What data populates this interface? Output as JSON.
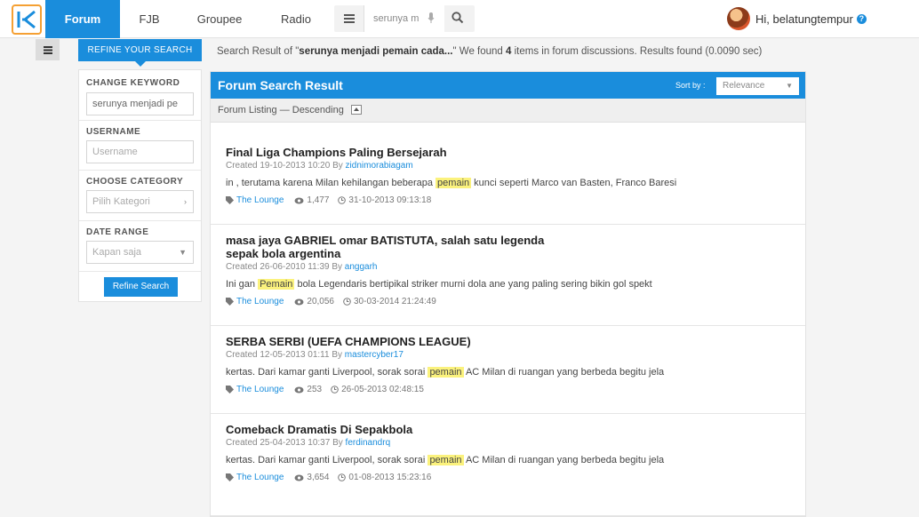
{
  "nav": {
    "tabs": [
      {
        "label": "Forum"
      },
      {
        "label": "FJB"
      },
      {
        "label": "Groupee"
      },
      {
        "label": "Radio"
      }
    ],
    "search": {
      "value": "serunya m"
    },
    "user": {
      "greeting": "Hi, belatungtempur",
      "help": "?"
    }
  },
  "sidebar": {
    "header": "REFINE YOUR SEARCH",
    "keyword_label": "CHANGE KEYWORD",
    "keyword_value": "serunya menjadi pe",
    "username_label": "USERNAME",
    "username_placeholder": "Username",
    "category_label": "CHOOSE CATEGORY",
    "category_value": "Pilih Kategori",
    "date_label": "DATE RANGE",
    "date_value": "Kapan saja",
    "refine_button": "Refine Search"
  },
  "summary": {
    "prefix": "Search Result of \"",
    "query": "serunya menjadi pemain cada...",
    "middle": "\" We found ",
    "count": "4",
    "suffix": " items in forum discussions. Results found (0.0090 sec)"
  },
  "main": {
    "title": "Forum Search Result",
    "sort_label": "Sort by :",
    "sort_value": "Relevance",
    "listing": "Forum Listing — Descending"
  },
  "results": [
    {
      "title": "Final Liga Champions Paling Bersejarah",
      "created": "Created 19-10-2013 10:20 By ",
      "author": "zidnimorabiagam",
      "pre": "in , terutama karena Milan kehilangan beberapa ",
      "hl": "pemain",
      "post": " kunci seperti Marco van Basten, Franco Baresi",
      "category": "The Lounge",
      "views": "1,477",
      "date": "31-10-2013 09:13:18"
    },
    {
      "title": "masa jaya GABRIEL omar BATISTUTA, salah satu legenda sepak bola argentina",
      "created": "Created 26-06-2010 11:39 By ",
      "author": "anggarh",
      "pre": "Ini gan ",
      "hl": "Pemain",
      "post": " bola Legendaris bertipikal striker murni dola ane yang paling sering bikin gol spekt",
      "category": "The Lounge",
      "views": "20,056",
      "date": "30-03-2014 21:24:49"
    },
    {
      "title": "SERBA SERBI (UEFA CHAMPIONS LEAGUE)",
      "created": "Created 12-05-2013 01:11 By ",
      "author": "mastercyber17",
      "pre": "kertas. Dari kamar ganti Liverpool, sorak sorai ",
      "hl": "pemain",
      "post": " AC Milan di ruangan yang berbeda begitu jela",
      "category": "The Lounge",
      "views": "253",
      "date": "26-05-2013 02:48:15"
    },
    {
      "title": "Comeback Dramatis Di Sepakbola",
      "created": "Created 25-04-2013 10:37 By ",
      "author": "ferdinandrq",
      "pre": "kertas. Dari kamar ganti Liverpool, sorak sorai ",
      "hl": "pemain",
      "post": " AC Milan di ruangan yang berbeda begitu jela",
      "category": "The Lounge",
      "views": "3,654",
      "date": "01-08-2013 15:23:16"
    }
  ],
  "colors": {
    "accent": "#1a8ddc",
    "logo_border": "#f5a033",
    "highlight": "#fbf27d"
  }
}
